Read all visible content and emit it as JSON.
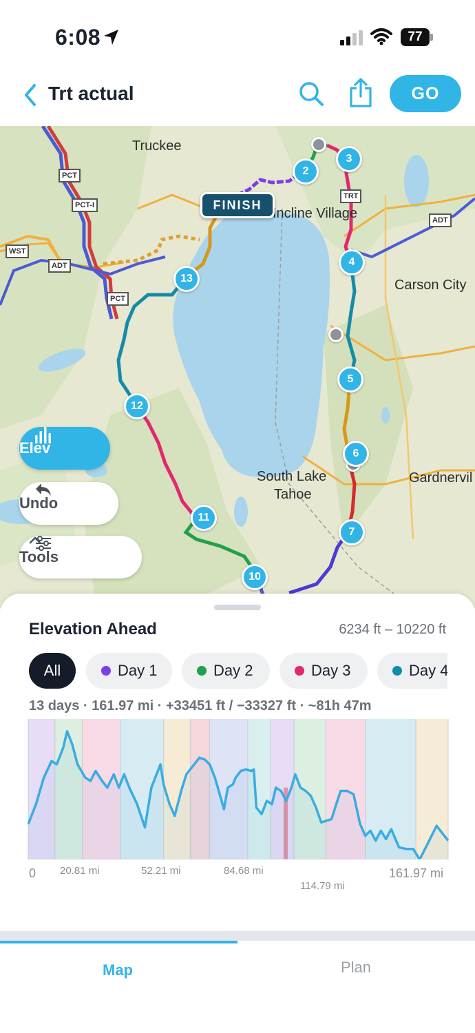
{
  "status_bar": {
    "time": "6:08",
    "battery": "77"
  },
  "nav": {
    "title": "Trt actual",
    "go_label": "GO"
  },
  "map": {
    "labels": {
      "truckee": "Truckee",
      "incline": "Incline Village",
      "carson": "Carson City",
      "south_lake_1": "South Lake",
      "south_lake_2": "Tahoe",
      "gardnerville": "Gardnervil"
    },
    "shields": [
      "PCT",
      "PCT-I",
      "WST",
      "ADT",
      "PCT",
      "ADT",
      "TRT",
      "ADT"
    ],
    "finish_label": "FINISH",
    "waypoints": [
      "2",
      "3",
      "4",
      "5",
      "6",
      "7",
      "10",
      "11",
      "12",
      "13"
    ],
    "buttons": {
      "elev": "Elev",
      "undo": "Undo",
      "tools": "Tools"
    }
  },
  "sheet": {
    "title": "Elevation Ahead",
    "range": "6234 ft – 10220 ft",
    "chips": [
      {
        "label": "All"
      },
      {
        "label": "Day 1",
        "color": "#7b3fe4"
      },
      {
        "label": "Day 2",
        "color": "#22a04b"
      },
      {
        "label": "Day 3",
        "color": "#e2276f"
      },
      {
        "label": "Day 4",
        "color": "#148ba7"
      }
    ],
    "stats": "13 days  ·  161.97 mi  ·  +33451 ft / −33327 ft  ·  ~81h 47m",
    "x_labels": [
      "0",
      "20.81 mi",
      "52.21 mi",
      "84.68 mi",
      "114.79 mi",
      "161.97 mi"
    ]
  },
  "chart_data": {
    "type": "area",
    "title": "Elevation Ahead",
    "xlabel": "",
    "ylabel": "",
    "x_unit": "mi",
    "y_unit": "ft",
    "xlim": [
      0,
      161.97
    ],
    "ylim": [
      6234,
      10220
    ],
    "x_ticks": [
      "0",
      "20.81 mi",
      "52.21 mi",
      "84.68 mi",
      "114.79 mi",
      "161.97 mi"
    ],
    "x": [
      0,
      3,
      6,
      9,
      11,
      13.5,
      15,
      17,
      19,
      22,
      24,
      26,
      28.5,
      30.5,
      33,
      35,
      37,
      39,
      42,
      45,
      47.5,
      49,
      51,
      52.2,
      54.5,
      56.5,
      59,
      61,
      63,
      66,
      68,
      70,
      72,
      73.5,
      75.5,
      77,
      79,
      80,
      82,
      84,
      86,
      87,
      88,
      90,
      92,
      94,
      95.5,
      97.5,
      99.5,
      101.5,
      103,
      105,
      107,
      109,
      111,
      113,
      115,
      117,
      119,
      120.5,
      123,
      125.5,
      128,
      130,
      132,
      134,
      136,
      138,
      140,
      143,
      146,
      148.5,
      151,
      154,
      157.5,
      161.97
    ],
    "y": [
      7300,
      7900,
      8700,
      9200,
      9100,
      9600,
      10100,
      9700,
      9100,
      8700,
      8600,
      8900,
      8600,
      8400,
      8800,
      8400,
      8800,
      8400,
      7900,
      7200,
      8400,
      8700,
      9100,
      8500,
      7900,
      7550,
      8300,
      8800,
      9000,
      9300,
      9250,
      9100,
      8700,
      8300,
      7750,
      8400,
      8500,
      8700,
      8900,
      8950,
      8900,
      8950,
      7800,
      7600,
      8000,
      7900,
      8400,
      8300,
      8000,
      8400,
      8800,
      8400,
      8300,
      8150,
      7800,
      7350,
      7400,
      7450,
      7950,
      8300,
      8300,
      8200,
      7300,
      6950,
      7100,
      6800,
      7100,
      6850,
      7150,
      6600,
      6550,
      6550,
      6234,
      6700,
      7250,
      6800
    ],
    "day_boundaries_mi": [
      0,
      10.3,
      20.81,
      35.5,
      52.21,
      62.5,
      70,
      84.68,
      93.5,
      102.5,
      114.79,
      130,
      149.5,
      161.97
    ]
  }
}
